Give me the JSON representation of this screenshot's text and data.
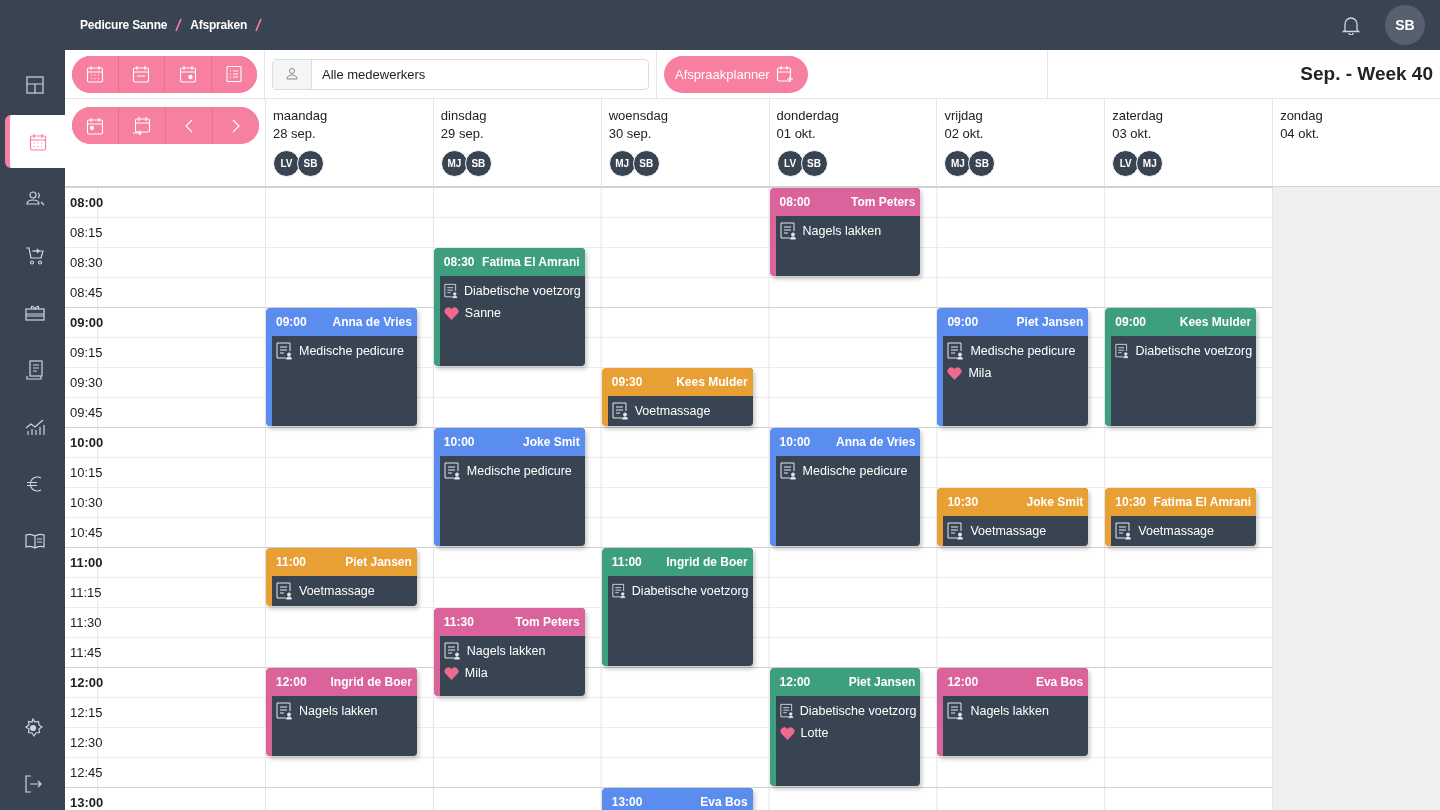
{
  "breadcrumb": [
    "Pedicure Sanne",
    "Afspraken"
  ],
  "user": {
    "initials": "SB"
  },
  "sidebar": {
    "items": [
      {
        "selected": false
      },
      {
        "selected": true
      },
      {
        "selected": false
      },
      {
        "selected": false
      },
      {
        "selected": false
      },
      {
        "selected": false
      },
      {
        "selected": false
      },
      {
        "selected": false
      },
      {
        "selected": false
      }
    ]
  },
  "toolbar": {
    "employee_select": {
      "value": "Alle medewerkers"
    },
    "planner_button": "Afspraakplanner",
    "title": "Sep. - Week 40"
  },
  "times": [
    {
      "label": "08:00",
      "hour": true
    },
    {
      "label": "08:15",
      "hour": false
    },
    {
      "label": "08:30",
      "hour": false
    },
    {
      "label": "08:45",
      "hour": false
    },
    {
      "label": "09:00",
      "hour": true
    },
    {
      "label": "09:15",
      "hour": false
    },
    {
      "label": "09:30",
      "hour": false
    },
    {
      "label": "09:45",
      "hour": false
    },
    {
      "label": "10:00",
      "hour": true
    },
    {
      "label": "10:15",
      "hour": false
    },
    {
      "label": "10:30",
      "hour": false
    },
    {
      "label": "10:45",
      "hour": false
    },
    {
      "label": "11:00",
      "hour": true
    },
    {
      "label": "11:15",
      "hour": false
    },
    {
      "label": "11:30",
      "hour": false
    },
    {
      "label": "11:45",
      "hour": false
    },
    {
      "label": "12:00",
      "hour": true
    },
    {
      "label": "12:15",
      "hour": false
    },
    {
      "label": "12:30",
      "hour": false
    },
    {
      "label": "12:45",
      "hour": false
    },
    {
      "label": "13:00",
      "hour": true
    }
  ],
  "days": [
    {
      "name": "maandag",
      "date": "28 sep.",
      "staff": [
        "LV",
        "SB"
      ],
      "closed": false,
      "column": [
        {
          "kind": "free"
        },
        {
          "kind": "free"
        },
        {
          "kind": "free"
        },
        {
          "kind": "free"
        },
        {
          "kind": "appointment",
          "time": "09:00",
          "client": "Anna de Vries",
          "color": "#5b8def",
          "service": "Medische pedicure"
        },
        {
          "kind": "continued"
        },
        {
          "kind": "continued"
        },
        {
          "kind": "continued"
        },
        {
          "kind": "free"
        },
        {
          "kind": "free"
        },
        {
          "kind": "free"
        },
        {
          "kind": "free"
        },
        {
          "kind": "appointment",
          "time": "11:00",
          "client": "Piet Jansen",
          "color": "#e8a035",
          "service": "Voetmassage"
        },
        {
          "kind": "continued"
        },
        {
          "kind": "free"
        },
        {
          "kind": "free"
        },
        {
          "kind": "appointment",
          "time": "12:00",
          "client": "Ingrid de Boer",
          "color": "#d9639a",
          "service": "Nagels lakken"
        },
        {
          "kind": "continued"
        },
        {
          "kind": "continued"
        }
      ]
    },
    {
      "name": "dinsdag",
      "date": "29 sep.",
      "staff": [
        "MJ",
        "SB"
      ],
      "closed": false,
      "column": [
        {
          "kind": "free"
        },
        {
          "kind": "free"
        },
        {
          "kind": "appointment",
          "time": "08:30",
          "client": "Fatima El Amrani",
          "color": "#3e9e80",
          "service": "Diabetische voetzorg",
          "employee": "Sanne"
        },
        {
          "kind": "continued"
        },
        {
          "kind": "continued"
        },
        {
          "kind": "continued"
        },
        {
          "kind": "free"
        },
        {
          "kind": "free"
        },
        {
          "kind": "appointment",
          "time": "10:00",
          "client": "Joke Smit",
          "color": "#5b8def",
          "service": "Medische pedicure"
        },
        {
          "kind": "continued"
        },
        {
          "kind": "continued"
        },
        {
          "kind": "continued"
        },
        {
          "kind": "free"
        },
        {
          "kind": "free"
        },
        {
          "kind": "appointment",
          "time": "11:30",
          "client": "Tom Peters",
          "color": "#d9639a",
          "service": "Nagels lakken",
          "employee": "Mila"
        },
        {
          "kind": "continued"
        },
        {
          "kind": "continued"
        }
      ]
    },
    {
      "name": "woensdag",
      "date": "30 sep.",
      "staff": [
        "MJ",
        "SB"
      ],
      "closed": false,
      "column": [
        {
          "kind": "free"
        },
        {
          "kind": "free"
        },
        {
          "kind": "free"
        },
        {
          "kind": "free"
        },
        {
          "kind": "free"
        },
        {
          "kind": "free"
        },
        {
          "kind": "appointment",
          "time": "09:30",
          "client": "Kees Mulder",
          "color": "#e8a035",
          "service": "Voetmassage"
        },
        {
          "kind": "continued"
        },
        {
          "kind": "free"
        },
        {
          "kind": "free"
        },
        {
          "kind": "free"
        },
        {
          "kind": "free"
        },
        {
          "kind": "appointment",
          "time": "11:00",
          "client": "Ingrid de Boer",
          "color": "#3e9e80",
          "service": "Diabetische voetzorg"
        },
        {
          "kind": "continued"
        },
        {
          "kind": "continued"
        },
        {
          "kind": "continued"
        },
        {
          "kind": "free"
        },
        {
          "kind": "free"
        },
        {
          "kind": "free"
        },
        {
          "kind": "free"
        },
        {
          "kind": "appointment",
          "time": "13:00",
          "client": "Eva Bos",
          "color": "#5b8def"
        }
      ]
    },
    {
      "name": "donderdag",
      "date": "01 okt.",
      "staff": [
        "LV",
        "SB"
      ],
      "closed": false,
      "column": [
        {
          "kind": "appointment",
          "time": "08:00",
          "client": "Tom Peters",
          "color": "#d9639a",
          "service": "Nagels lakken"
        },
        {
          "kind": "continued"
        },
        {
          "kind": "continued"
        },
        {
          "kind": "free"
        },
        {
          "kind": "free"
        },
        {
          "kind": "free"
        },
        {
          "kind": "free"
        },
        {
          "kind": "free"
        },
        {
          "kind": "appointment",
          "time": "10:00",
          "client": "Anna de Vries",
          "color": "#5b8def",
          "service": "Medische pedicure"
        },
        {
          "kind": "continued"
        },
        {
          "kind": "continued"
        },
        {
          "kind": "continued"
        },
        {
          "kind": "free"
        },
        {
          "kind": "free"
        },
        {
          "kind": "free"
        },
        {
          "kind": "free"
        },
        {
          "kind": "appointment",
          "time": "12:00",
          "client": "Piet Jansen",
          "color": "#3e9e80",
          "service": "Diabetische voetzorg",
          "employee": "Lotte"
        },
        {
          "kind": "continued"
        },
        {
          "kind": "continued"
        },
        {
          "kind": "continued"
        }
      ]
    },
    {
      "name": "vrijdag",
      "date": "02 okt.",
      "staff": [
        "MJ",
        "SB"
      ],
      "closed": false,
      "column": [
        {
          "kind": "free"
        },
        {
          "kind": "free"
        },
        {
          "kind": "free"
        },
        {
          "kind": "free"
        },
        {
          "kind": "appointment",
          "time": "09:00",
          "client": "Piet Jansen",
          "color": "#5b8def",
          "service": "Medische pedicure",
          "employee": "Mila"
        },
        {
          "kind": "continued"
        },
        {
          "kind": "continued"
        },
        {
          "kind": "continued"
        },
        {
          "kind": "free"
        },
        {
          "kind": "free"
        },
        {
          "kind": "appointment",
          "time": "10:30",
          "client": "Joke Smit",
          "color": "#e8a035",
          "service": "Voetmassage"
        },
        {
          "kind": "continued"
        },
        {
          "kind": "free"
        },
        {
          "kind": "free"
        },
        {
          "kind": "free"
        },
        {
          "kind": "free"
        },
        {
          "kind": "appointment",
          "time": "12:00",
          "client": "Eva Bos",
          "color": "#d9639a",
          "service": "Nagels lakken"
        },
        {
          "kind": "continued"
        },
        {
          "kind": "continued"
        }
      ]
    },
    {
      "name": "zaterdag",
      "date": "03 okt.",
      "staff": [
        "LV",
        "MJ"
      ],
      "closed": false,
      "column": [
        {
          "kind": "free"
        },
        {
          "kind": "free"
        },
        {
          "kind": "free"
        },
        {
          "kind": "free"
        },
        {
          "kind": "appointment",
          "time": "09:00",
          "client": "Kees Mulder",
          "color": "#3e9e80",
          "service": "Diabetische voetzorg"
        },
        {
          "kind": "continued"
        },
        {
          "kind": "continued"
        },
        {
          "kind": "continued"
        },
        {
          "kind": "free"
        },
        {
          "kind": "free"
        },
        {
          "kind": "appointment",
          "time": "10:30",
          "client": "Fatima El Amrani",
          "color": "#e8a035",
          "service": "Voetmassage"
        },
        {
          "kind": "continued"
        }
      ]
    },
    {
      "name": "zondag",
      "date": "04 okt.",
      "closed": true
    }
  ]
}
